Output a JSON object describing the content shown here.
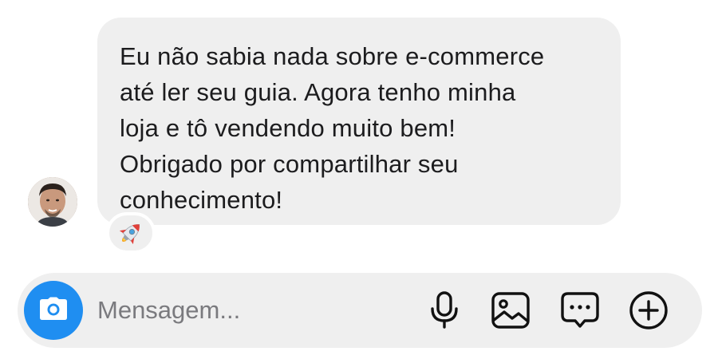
{
  "message": {
    "text": "Eu não sabia nada sobre e-commerce\naté ler seu guia. Agora tenho minha\nloja e tô vendendo muito bem!\nObrigado por compartilhar seu\nconhecimento!",
    "reaction_emoji": "rocket-emoji",
    "bubble_color": "#efefef"
  },
  "composer": {
    "placeholder": "Mensagem...",
    "value": "",
    "camera_color": "#1f8ef1",
    "icons": [
      "camera-icon",
      "microphone-icon",
      "gallery-icon",
      "sticker-icon",
      "plus-circle-icon"
    ]
  }
}
